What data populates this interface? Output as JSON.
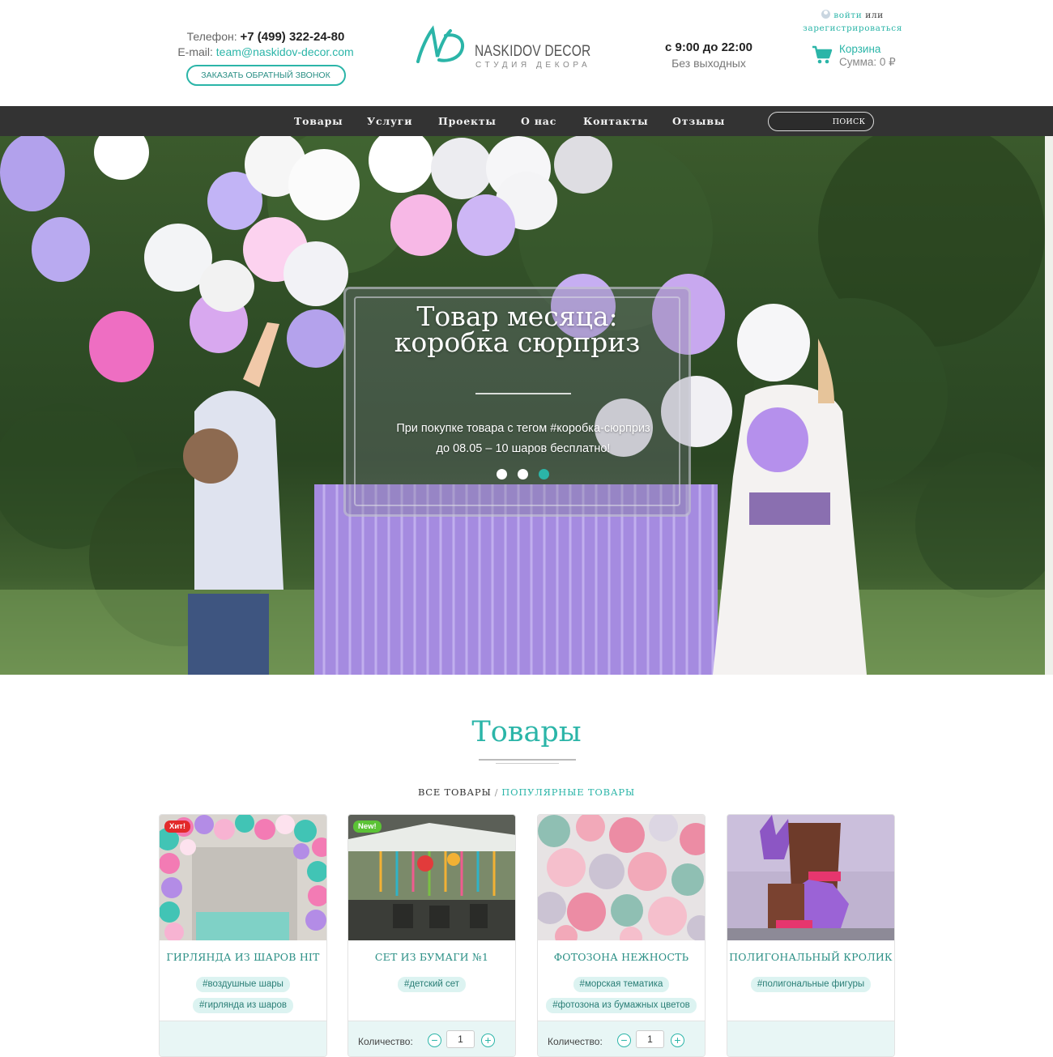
{
  "header": {
    "phone_label": "Телефон: ",
    "phone_number": "+7 (499) 322-24-80",
    "email_label": "E-mail: ",
    "email": "team@naskidov-decor.com",
    "callback_button": "ЗАКАЗАТЬ ОБРАТНЫЙ ЗВОНОК",
    "logo_title": "NASKIDOV DECOR",
    "logo_subtitle": "СТУДИЯ ДЕКОРА",
    "hours": "с 9:00 до 22:00",
    "days": "Без выходных",
    "login": "войти",
    "or": " или",
    "register": "зарегистрироваться",
    "cart_title": "Корзина",
    "cart_sum": "Сумма: 0 ₽"
  },
  "nav": {
    "items": [
      "Товары",
      "Услуги",
      "Проекты",
      "О нас",
      "Контакты",
      "Отзывы"
    ],
    "search_placeholder": "",
    "search_button": "ПОИСК"
  },
  "hero": {
    "title_line1": "Товар месяца:",
    "title_line2": "коробка сюрприз",
    "text": "При покупке товара с тегом #коробка-сюрприз до 08.05 – 10 шаров бесплатно!",
    "slides": 3,
    "active_slide": 3
  },
  "products_section": {
    "title": "Товары",
    "filter_all": "ВСЕ ТОВАРЫ",
    "filter_sep": "/",
    "filter_popular": "ПОПУЛЯРНЫЕ ТОВАРЫ",
    "quantity_label": "Количество:",
    "cards": [
      {
        "name": "ГИРЛЯНДА ИЗ ШАРОВ HIT",
        "badge": "Хит!",
        "tags": [
          "#воздушные шары",
          "#гирлянда из шаров"
        ],
        "quantity": ""
      },
      {
        "name": "СЕТ ИЗ БУМАГИ №1",
        "badge": "New!",
        "tags": [
          "#детский сет"
        ],
        "quantity": "1"
      },
      {
        "name": "ФОТОЗОНА НЕЖНОСТЬ",
        "badge": "",
        "tags": [
          "#морская тематика",
          "#фотозона из бумажных цветов"
        ],
        "quantity": "1"
      },
      {
        "name": "ПОЛИГОНАЛЬНЫЙ КРОЛИК",
        "badge": "",
        "tags": [
          "#полигональные фигуры"
        ],
        "quantity": ""
      }
    ]
  },
  "colors": {
    "accent": "#2bb5a8",
    "nav_bg": "#333333",
    "hit_badge": "#e22a2a",
    "new_badge": "#5bc236"
  }
}
